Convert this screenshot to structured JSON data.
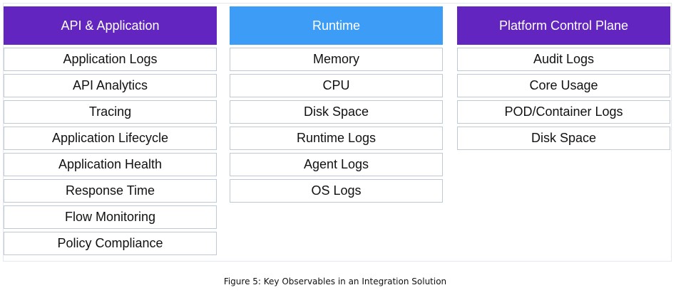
{
  "columns": [
    {
      "title": "API & Application",
      "header_color": "#6325bf",
      "items": [
        "Application Logs",
        "API Analytics",
        "Tracing",
        "Application Lifecycle",
        "Application Health",
        "Response Time",
        "Flow Monitoring",
        "Policy Compliance"
      ]
    },
    {
      "title": "Runtime",
      "header_color": "#3d9df6",
      "items": [
        "Memory",
        "CPU",
        "Disk Space",
        "Runtime Logs",
        "Agent Logs",
        "OS Logs"
      ]
    },
    {
      "title": "Platform Control Plane",
      "header_color": "#6325bf",
      "items": [
        "Audit Logs",
        "Core Usage",
        "POD/Container Logs",
        "Disk Space"
      ]
    }
  ],
  "caption": "Figure 5: Key Observables in an Integration Solution"
}
